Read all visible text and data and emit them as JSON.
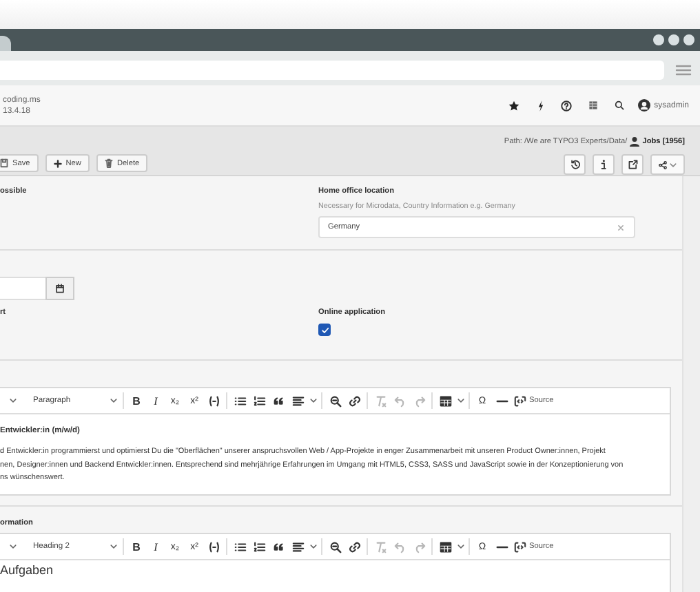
{
  "site": {
    "name": "coding.ms",
    "version": "13.4.18"
  },
  "user": {
    "name": "sysadmin"
  },
  "docheader": {
    "path": "Path: /We are TYPO3 Experts/Data/",
    "record": "Jobs [1956]",
    "buttons": [
      {
        "kind": "save",
        "label": "Save"
      },
      {
        "kind": "new",
        "label": "New"
      },
      {
        "kind": "delete",
        "label": "Delete"
      }
    ]
  },
  "form": {
    "row_1": {
      "left_label": "ossible",
      "right_label": "Home office location",
      "right_hint": "Necessary for Microdata, Country Information e.g. Germany",
      "right_value": "Germany"
    },
    "row_2": {
      "left_label": "rt",
      "right_label": "Online application",
      "checked": true
    },
    "editors": [
      {
        "toolbar": [
          {
            "kind": "caret",
            "disabled": false
          },
          {
            "kind": "select",
            "label": "Paragraph",
            "disabled": false
          },
          {
            "kind": "sep"
          },
          {
            "kind": "bold",
            "text": "B",
            "disabled": false
          },
          {
            "kind": "italic",
            "text": "I",
            "disabled": false
          },
          {
            "kind": "glyph",
            "text": "x₂",
            "disabled": false
          },
          {
            "kind": "glyph",
            "text": "x²",
            "disabled": false
          },
          {
            "kind": "code",
            "disabled": false
          },
          {
            "kind": "sep"
          },
          {
            "kind": "bullets",
            "disabled": false
          },
          {
            "kind": "numbers",
            "disabled": false
          },
          {
            "kind": "quote",
            "disabled": false
          },
          {
            "kind": "align",
            "disabled": false
          },
          {
            "kind": "caret",
            "disabled": false
          },
          {
            "kind": "sep"
          },
          {
            "kind": "find",
            "disabled": false
          },
          {
            "kind": "link",
            "disabled": false
          },
          {
            "kind": "sep"
          },
          {
            "kind": "clear",
            "disabled": true
          },
          {
            "kind": "undo",
            "disabled": true
          },
          {
            "kind": "redo",
            "disabled": true
          },
          {
            "kind": "sep"
          },
          {
            "kind": "table",
            "disabled": false
          },
          {
            "kind": "caret",
            "disabled": false
          },
          {
            "kind": "sep"
          },
          {
            "kind": "glyph",
            "text": "Ω",
            "disabled": false
          },
          {
            "kind": "hr",
            "disabled": false
          },
          {
            "kind": "source",
            "label": "Source",
            "disabled": false
          }
        ],
        "content": [
          {
            "kind": "heading",
            "text": "Entwickler:in (m/w/d)"
          },
          {
            "kind": "paragraph",
            "lines": [
              "d Entwickler:in programmierst und optimierst Du die \"Oberflächen\" unserer anspruchsvollen Web / App-Projekte in enger Zusammenarbeit mit unseren Product Owner:innen, Projekt",
              "nen, Designer:innen und Backend Entwickler:innen. Entsprechend sind mehrjährige Erfahrungen im Umgang mit HTML5, CSS3, SASS und JavaScript sowie in der Konzeptionierung von",
              "ns wünschenswert."
            ]
          }
        ]
      },
      {
        "label": "ormation",
        "toolbar": [
          {
            "kind": "caret",
            "disabled": false
          },
          {
            "kind": "select",
            "label": "Heading 2",
            "disabled": false
          },
          {
            "kind": "sep"
          },
          {
            "kind": "bold",
            "text": "B",
            "disabled": false
          },
          {
            "kind": "italic",
            "text": "I",
            "disabled": false
          },
          {
            "kind": "glyph",
            "text": "x₂",
            "disabled": false
          },
          {
            "kind": "glyph",
            "text": "x²",
            "disabled": false
          },
          {
            "kind": "code",
            "disabled": false
          },
          {
            "kind": "sep"
          },
          {
            "kind": "bullets",
            "disabled": false
          },
          {
            "kind": "numbers",
            "disabled": false
          },
          {
            "kind": "quote",
            "disabled": false
          },
          {
            "kind": "align",
            "disabled": false
          },
          {
            "kind": "caret",
            "disabled": false
          },
          {
            "kind": "sep"
          },
          {
            "kind": "find",
            "disabled": false
          },
          {
            "kind": "link",
            "disabled": false
          },
          {
            "kind": "sep"
          },
          {
            "kind": "clear",
            "disabled": true
          },
          {
            "kind": "undo",
            "disabled": true
          },
          {
            "kind": "redo",
            "disabled": true
          },
          {
            "kind": "sep"
          },
          {
            "kind": "table",
            "disabled": false
          },
          {
            "kind": "caret",
            "disabled": false
          },
          {
            "kind": "sep"
          },
          {
            "kind": "glyph",
            "text": "Ω",
            "disabled": false
          },
          {
            "kind": "hr",
            "disabled": false
          },
          {
            "kind": "source",
            "label": "Source",
            "disabled": false
          }
        ],
        "content": [
          {
            "kind": "heading2",
            "text": "Aufgaben"
          }
        ]
      }
    ]
  }
}
